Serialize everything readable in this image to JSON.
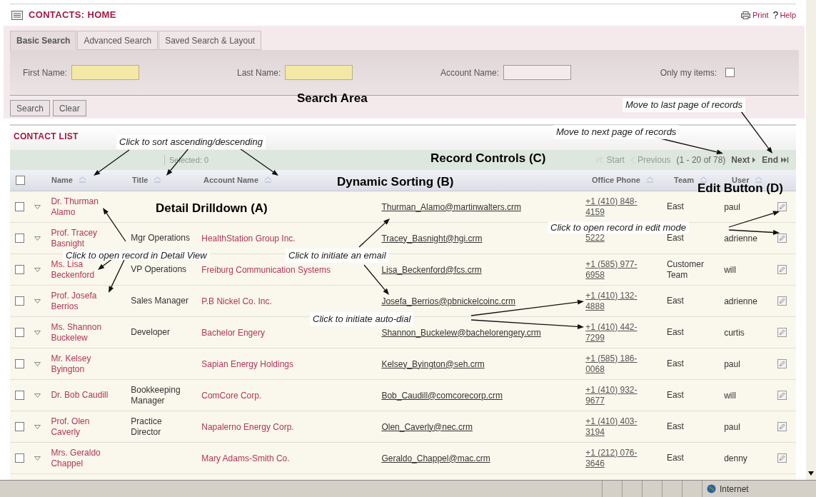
{
  "header": {
    "title": "CONTACTS: HOME",
    "print": "Print",
    "help_icon": "?",
    "help": "Help"
  },
  "search": {
    "tabs": [
      {
        "label": "Basic Search",
        "selected": true
      },
      {
        "label": "Advanced Search",
        "selected": false
      },
      {
        "label": "Saved Search & Layout",
        "selected": false
      }
    ],
    "fields": [
      {
        "label": "First Name:",
        "kind": "required"
      },
      {
        "label": "Last Name:",
        "kind": "required"
      },
      {
        "label": "Account Name:",
        "kind": "plain"
      }
    ],
    "only_mine": {
      "label": "Only my items:",
      "checked": false
    },
    "buttons": [
      "Search",
      "Clear"
    ]
  },
  "list": {
    "title": "CONTACT LIST",
    "selected_label": "Selected:",
    "selected_count": "0",
    "pager": [
      {
        "label": "Start",
        "kind": "first",
        "disabled": true
      },
      {
        "label": "Previous",
        "kind": "prev",
        "disabled": true
      },
      {
        "label": "(1 - 20 of 78)",
        "kind": "range"
      },
      {
        "label": "Next",
        "kind": "next",
        "disabled": false
      },
      {
        "label": "End",
        "kind": "last",
        "disabled": false
      }
    ],
    "select_all": {
      "checked": false
    },
    "columns": [
      {
        "label": "Name",
        "sortable": true
      },
      {
        "label": "Title",
        "sortable": true
      },
      {
        "label": "Account Name",
        "sortable": true
      },
      {},
      {
        "label": "Office Phone",
        "sortable": true
      },
      {
        "label": "Team",
        "sortable": true
      },
      {
        "label": "User",
        "sortable": true
      }
    ],
    "rows": [
      {
        "checked": false,
        "name": "Dr. Thurman Alamo",
        "email": "Thurman_Alamo@martinwalters.crm",
        "phone": "+1 (410) 848-4159",
        "team": "East",
        "user": "paul"
      },
      {
        "checked": false,
        "name": "Prof. Tracey Basnight",
        "title": "Mgr Operations",
        "account": "HealthStation Group Inc.",
        "email": "Tracey_Basnight@hgi.crm",
        "phone": "5222",
        "team": "East",
        "user": "adrienne"
      },
      {
        "checked": false,
        "name": "Ms. Lisa Beckenford",
        "title": "VP Operations",
        "account": "Freiburg Communication Systems",
        "email": "Lisa_Beckenford@fcs.crm",
        "phone": "+1 (585) 977-6958",
        "team": "Customer Team",
        "user": "will"
      },
      {
        "checked": false,
        "name": "Prof. Josefa Berrios",
        "title": "Sales Manager",
        "account": "P.B Nickel Co. Inc.",
        "email": "Josefa_Berrios@pbnickelcoinc.crm",
        "phone": "+1 (410) 132-4888",
        "team": "East",
        "user": "adrienne"
      },
      {
        "checked": false,
        "name": "Ms. Shannon Buckelew",
        "title": "Developer",
        "account": "Bachelor Engery",
        "email": "Shannon_Buckelew@bachelorengery.crm",
        "phone": "+1 (410) 442-7299",
        "team": "East",
        "user": "curtis"
      },
      {
        "checked": false,
        "name": "Mr. Kelsey Byington",
        "account": "Sapian Energy Holdings",
        "email": "Kelsey_Byington@seh.crm",
        "phone": "+1 (585) 186-0068",
        "team": "East",
        "user": "paul"
      },
      {
        "checked": false,
        "name": "Dr. Bob Caudill",
        "title": "Bookkeeping Manager",
        "account": "ComCore Corp.",
        "email": "Bob_Caudill@comcorecorp.crm",
        "phone": "+1 (410) 932-9677",
        "team": "East",
        "user": "will"
      },
      {
        "checked": false,
        "name": "Prof. Olen Caverly",
        "title": "Practice Director",
        "account": "Napalerno Energy Corp.",
        "email": "Olen_Caverly@nec.crm",
        "phone": "+1 (410) 403-3194",
        "team": "East",
        "user": "paul"
      },
      {
        "checked": false,
        "name": "Mrs. Geraldo Chappel",
        "account": "Mary Adams-Smith Co.",
        "email": "Geraldo_Chappel@mac.crm",
        "phone": "+1 (212) 076-3646",
        "team": "East",
        "user": "denny"
      }
    ]
  },
  "annotations": [
    {
      "kind": "heading",
      "text": "Search Area"
    },
    {
      "kind": "note",
      "text": "Move to last page of records"
    },
    {
      "kind": "note",
      "text": "Click to sort ascending/descending"
    },
    {
      "kind": "note",
      "text": "Move to next page of records"
    },
    {
      "kind": "heading",
      "text": "Record Controls (C)"
    },
    {
      "kind": "heading",
      "text": "Dynamic Sorting (B)"
    },
    {
      "kind": "heading",
      "text": "Edit Button (D)"
    },
    {
      "kind": "heading",
      "text": "Detail Drilldown (A)"
    },
    {
      "kind": "note",
      "text": "Click to open record in edit mode"
    },
    {
      "kind": "note",
      "text": "Click to open record in Detail View"
    },
    {
      "kind": "note",
      "text": "Click to initiate an email"
    },
    {
      "kind": "note",
      "text": "Click to initiate auto-dial"
    }
  ],
  "status_bar": {
    "zone": "Internet"
  }
}
